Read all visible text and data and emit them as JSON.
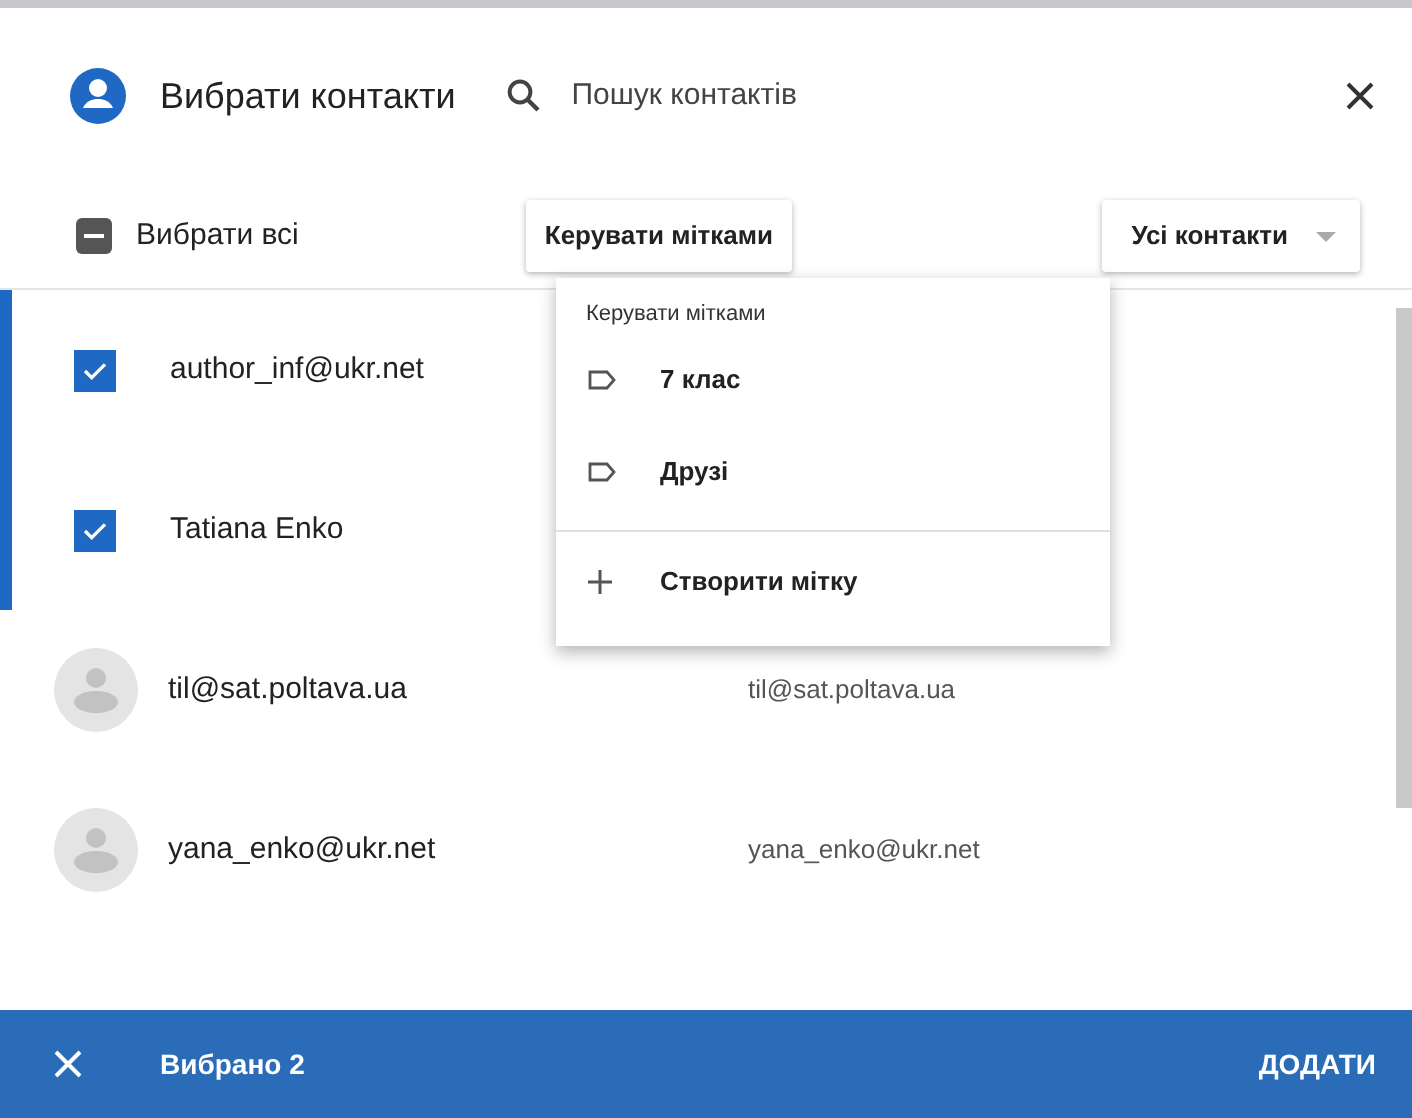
{
  "header": {
    "title": "Вибрати контакти",
    "search": {
      "placeholder": "Пошук контактів"
    }
  },
  "toolbar": {
    "select_all": {
      "label": "Вибрати всі",
      "indeterminate": true
    },
    "manage_labels_button": "Керувати мітками",
    "filter_dropdown": "Усі контакти"
  },
  "contacts": [
    {
      "name": "author_inf@ukr.net",
      "selected": true
    },
    {
      "name": "Tatiana Enko",
      "selected": true
    },
    {
      "name": "til@sat.poltava.ua",
      "email": "til@sat.poltava.ua",
      "selected": false
    },
    {
      "name": "yana_enko@ukr.net",
      "email": "yana_enko@ukr.net",
      "selected": false
    }
  ],
  "labels_menu": {
    "heading": "Керувати мітками",
    "items": [
      {
        "kind": "label",
        "text": "7 клас"
      },
      {
        "kind": "label",
        "text": "Друзі"
      },
      {
        "kind": "create",
        "text": "Створити мітку"
      }
    ]
  },
  "bottom_bar": {
    "status": "Вибрано 2",
    "action": "ДОДАТИ"
  }
}
